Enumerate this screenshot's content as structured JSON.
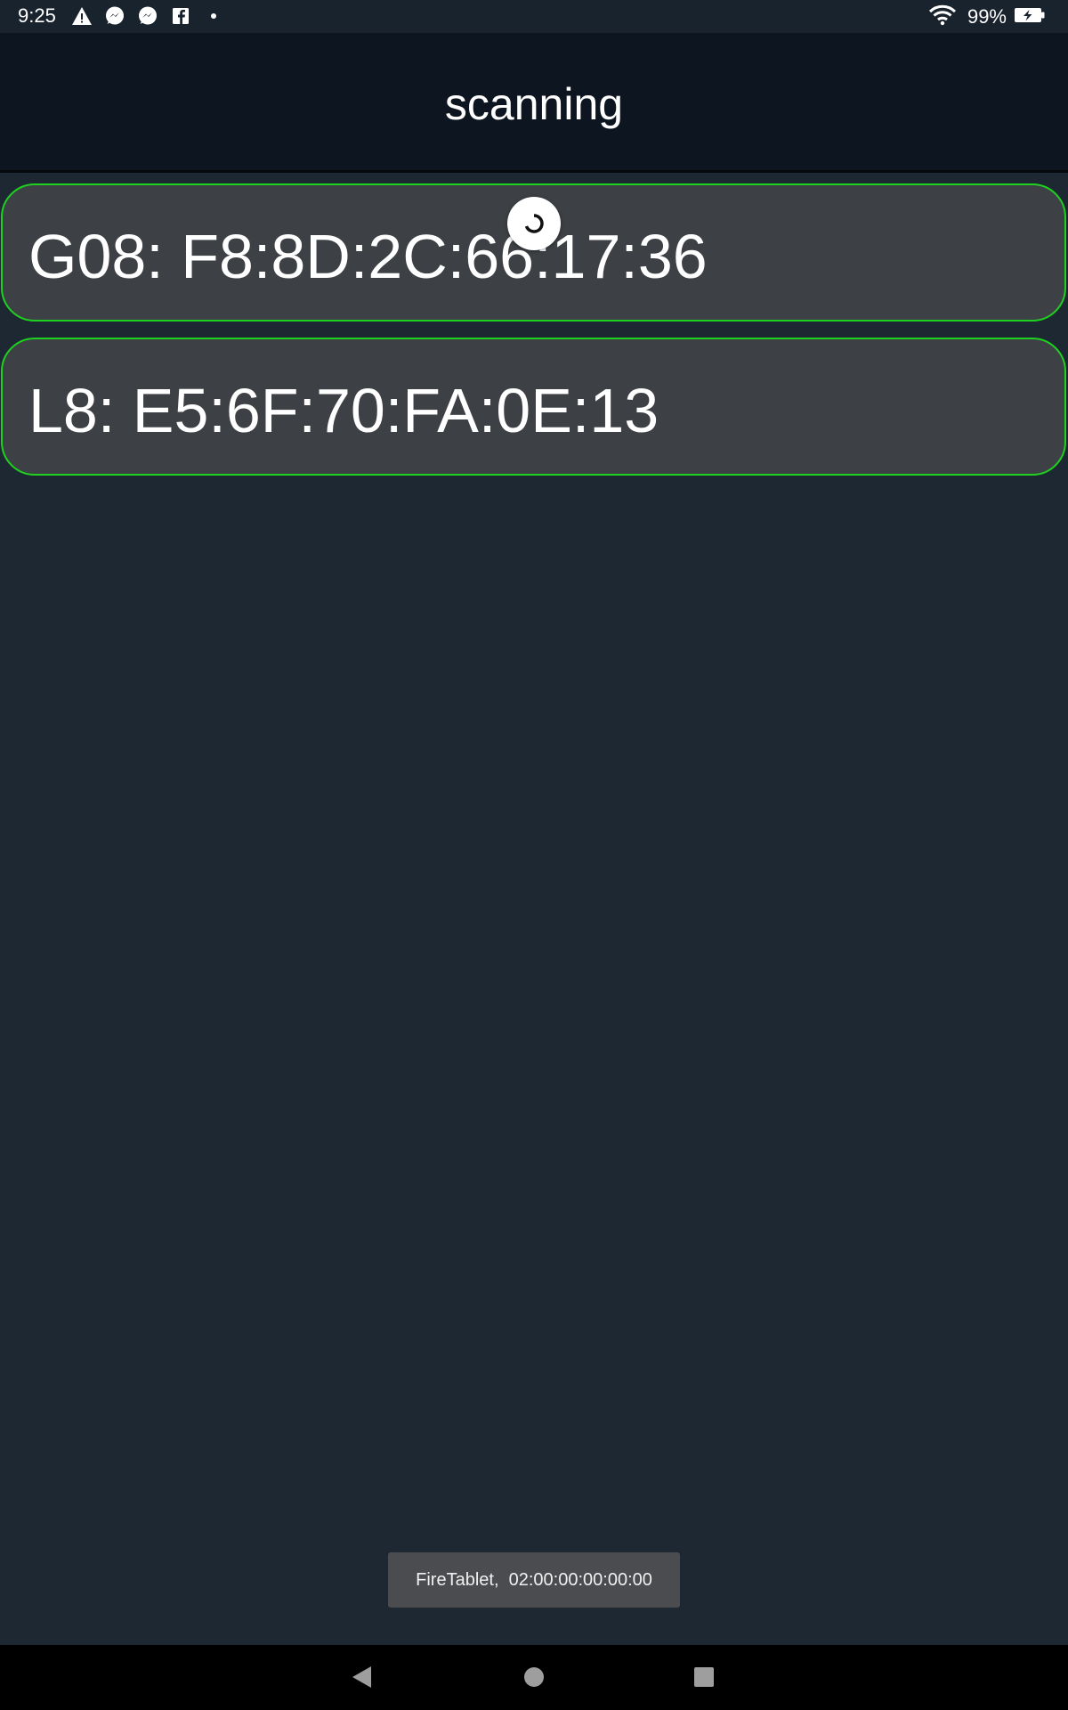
{
  "status_bar": {
    "time": "9:25",
    "notification_icons": [
      "warning-icon",
      "messenger-icon",
      "messenger-icon",
      "facebook-icon",
      "more-dot-icon"
    ],
    "wifi_icon": "wifi-icon",
    "battery_percent": "99%",
    "battery_icon": "battery-charging-icon"
  },
  "app_bar": {
    "title": "scanning"
  },
  "devices": [
    {
      "label": "G08: F8:8D:2C:66:17:36"
    },
    {
      "label": "L8: E5:6F:70:FA:0E:13"
    }
  ],
  "toast": {
    "text": "FireTablet,  02:00:00:00:00:00"
  },
  "nav_bar": {
    "back_icon": "back-triangle-icon",
    "home_icon": "home-circle-icon",
    "recents_icon": "recents-square-icon"
  },
  "colors": {
    "background": "#1e2833",
    "app_bar": "#0d1520",
    "card": "#3d4044",
    "card_border": "#1fd11f",
    "toast": "#4a4c4f"
  }
}
